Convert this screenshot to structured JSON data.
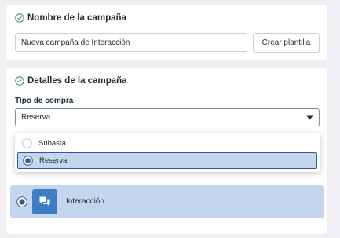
{
  "section1": {
    "title": "Nombre de la campaña",
    "name_value": "Nueva campaña de Interacción",
    "create_template_label": "Crear plantilla"
  },
  "section2": {
    "title": "Detalles de la campaña",
    "buy_type_label": "Tipo de compra",
    "buy_type_selected": "Reserva",
    "options": [
      {
        "label": "Subasta",
        "selected": false
      },
      {
        "label": "Reserva",
        "selected": true
      }
    ],
    "objective": {
      "label": "Interacción",
      "selected": true
    }
  },
  "colors": {
    "accent": "#2f5a97",
    "selected_bg": "#c4d6ee",
    "check": "#2f8a5b",
    "icon_tile": "#3e7cc4"
  },
  "icons": [
    "check-circle-icon",
    "caret-down-icon",
    "radio-icon",
    "chat-bubbles-icon"
  ]
}
